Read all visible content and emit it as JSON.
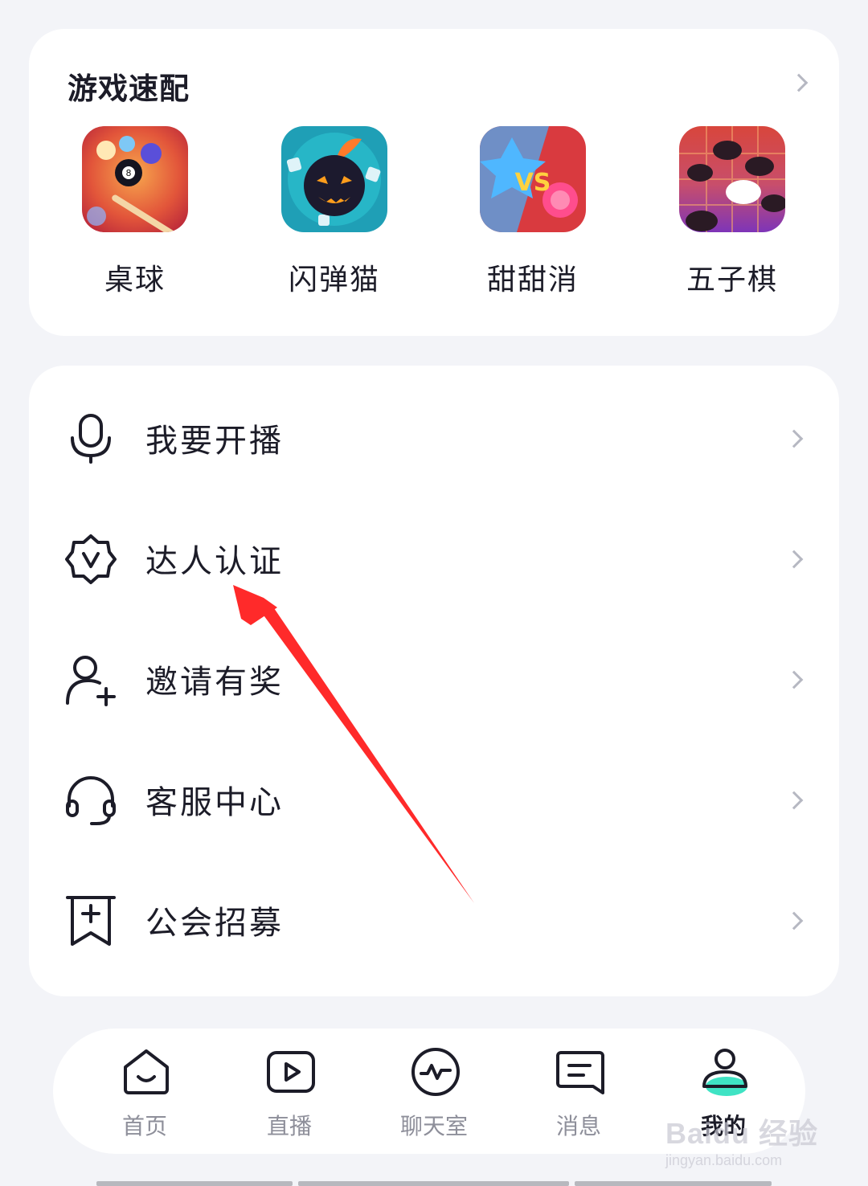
{
  "games_section": {
    "title": "游戏速配",
    "games": [
      {
        "name": "桌球",
        "icon": "billiards-icon"
      },
      {
        "name": "闪弹猫",
        "icon": "bomb-cat-icon"
      },
      {
        "name": "甜甜消",
        "icon": "candy-vs-icon"
      },
      {
        "name": "五子棋",
        "icon": "gomoku-icon"
      }
    ]
  },
  "menu": {
    "items": [
      {
        "label": "我要开播",
        "icon": "microphone-icon"
      },
      {
        "label": "达人认证",
        "icon": "verified-badge-icon"
      },
      {
        "label": "邀请有奖",
        "icon": "add-user-icon"
      },
      {
        "label": "客服中心",
        "icon": "headset-icon"
      },
      {
        "label": "公会招募",
        "icon": "bookmark-plus-icon"
      }
    ]
  },
  "bottom_nav": {
    "items": [
      {
        "label": "首页",
        "icon": "home-icon",
        "active": false
      },
      {
        "label": "直播",
        "icon": "play-icon",
        "active": false
      },
      {
        "label": "聊天室",
        "icon": "pulse-icon",
        "active": false
      },
      {
        "label": "消息",
        "icon": "message-icon",
        "active": false
      },
      {
        "label": "我的",
        "icon": "profile-icon",
        "active": true
      }
    ]
  },
  "watermark": {
    "brand": "Baidu 经验",
    "url": "jingyan.baidu.com"
  },
  "colors": {
    "background": "#f3f4f8",
    "card": "#ffffff",
    "text": "#1c1c28",
    "chevron": "#b6b8c2",
    "nav_inactive": "#8e8f9a",
    "accent": "#3fe3c4",
    "annotation_arrow": "#ff2a2a"
  }
}
